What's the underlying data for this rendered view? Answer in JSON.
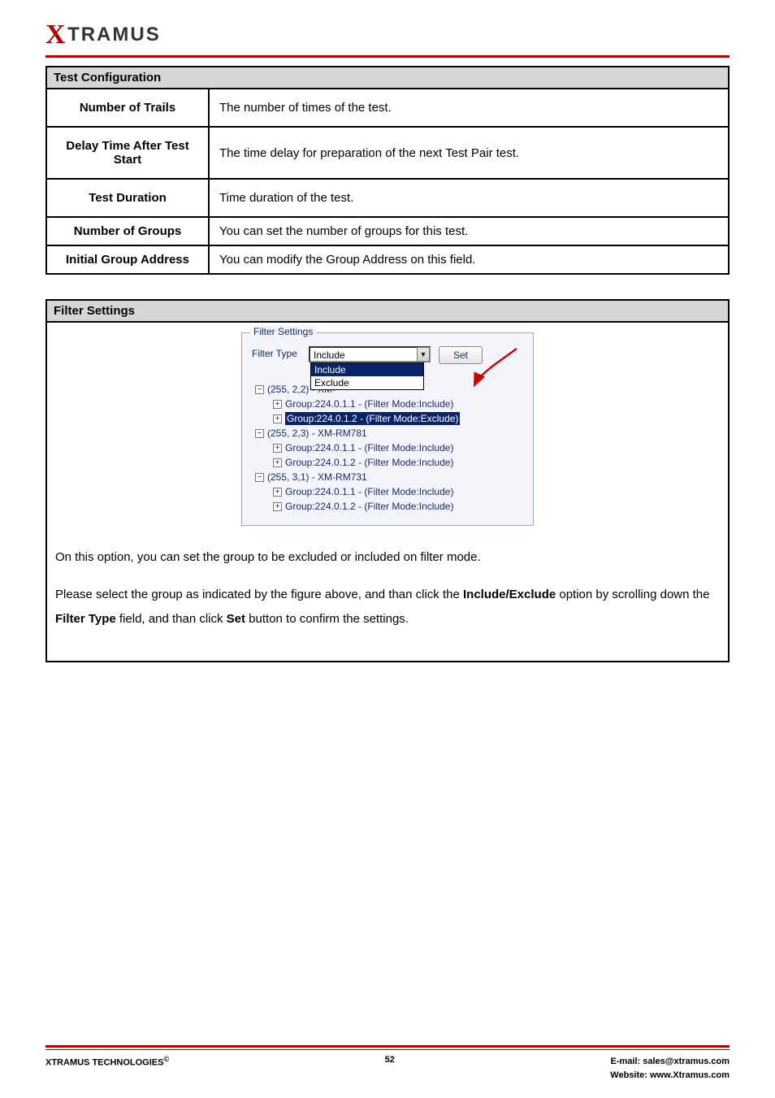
{
  "brand": {
    "x": "X",
    "rest": "TRAMUS"
  },
  "config_table": {
    "title": "Test Configuration",
    "rows": [
      {
        "label": "Number of Trails",
        "desc": "The number of times of the test."
      },
      {
        "label": "Delay Time After Test Start",
        "desc": "The time delay for preparation of the next Test Pair test."
      },
      {
        "label": "Test Duration",
        "desc": "Time duration of the test."
      },
      {
        "label": "Number of Groups",
        "desc": "You can set the number of groups for this test."
      },
      {
        "label": "Initial Group Address",
        "desc": "You can modify the Group Address on this field."
      }
    ]
  },
  "filter": {
    "header": "Filter Settings",
    "panel_label": "Filter Settings",
    "type_label": "Filter Type",
    "combo_value": "Include",
    "options": {
      "include": "Include",
      "exclude": "Exclude"
    },
    "set_button": "Set",
    "tree": {
      "n0": "(255, 2,2) - XM-",
      "n0_g1": "Group:224.0.1.1 - (Filter Mode:Include)",
      "n0_g2": "Group:224.0.1.2 - (Filter Mode:Exclude)",
      "n1": "(255, 2,3) - XM-RM781",
      "n1_g1": "Group:224.0.1.1 - (Filter Mode:Include)",
      "n1_g2": "Group:224.0.1.2 - (Filter Mode:Include)",
      "n2": "(255, 3,1) - XM-RM731",
      "n2_g1": "Group:224.0.1.1 - (Filter Mode:Include)",
      "n2_g2": "Group:224.0.1.2 - (Filter Mode:Include)"
    },
    "para1": "On this option, you can set the group to be excluded or included on filter mode.",
    "para2_a": "Please select the group as indicated by the figure above, and than click the ",
    "para2_b": "Include/Exclude",
    "para2_c": " option by scrolling down the ",
    "para2_d": "Filter Type",
    "para2_e": " field, and than click ",
    "para2_f": "Set",
    "para2_g": " button to confirm the settings."
  },
  "footer": {
    "left_a": "XTRAMUS TECHNOLOGIES",
    "left_sup": "©",
    "page": "52",
    "r1": "E-mail: sales@xtramus.com",
    "r2": "Website:  www.Xtramus.com"
  }
}
